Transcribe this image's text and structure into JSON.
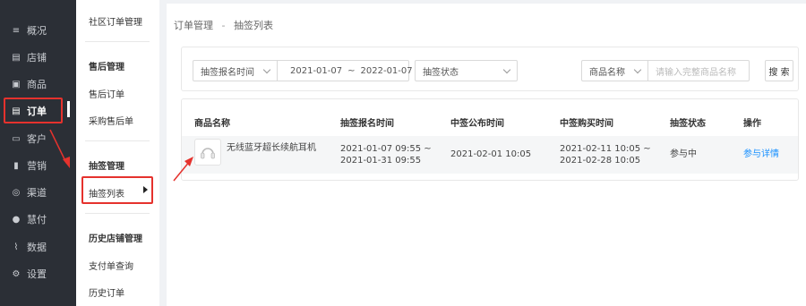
{
  "nav": {
    "items": [
      {
        "label": "概况",
        "icon": "list-icon",
        "glyph": "≡"
      },
      {
        "label": "店铺",
        "icon": "store-icon",
        "glyph": "▤"
      },
      {
        "label": "商品",
        "icon": "bag-icon",
        "glyph": "▣"
      },
      {
        "label": "订单",
        "icon": "order-icon",
        "glyph": "▤"
      },
      {
        "label": "客户",
        "icon": "customer-icon",
        "glyph": "▭"
      },
      {
        "label": "营销",
        "icon": "chart-icon",
        "glyph": "▮"
      },
      {
        "label": "渠道",
        "icon": "channel-icon",
        "glyph": "◎"
      },
      {
        "label": "慧付",
        "icon": "pay-icon",
        "glyph": "●"
      },
      {
        "label": "数据",
        "icon": "data-icon",
        "glyph": "⌇"
      },
      {
        "label": "设置",
        "icon": "settings-icon",
        "glyph": "⚙"
      }
    ],
    "active_index": 3
  },
  "submenu": {
    "community_orders": "社区订单管理",
    "after_sale_group": "售后管理",
    "after_sale_orders": "售后订单",
    "purchase_after_sale": "采购售后单",
    "lottery_group": "抽签管理",
    "lottery_list": "抽签列表",
    "history_group": "历史店铺管理",
    "payment_query": "支付单查询",
    "history_orders": "历史订单"
  },
  "breadcrumb": {
    "parent": "订单管理",
    "separator": "-",
    "current": "抽签列表"
  },
  "filters": {
    "time_type": "抽签报名时间",
    "date_start": "2021-01-07",
    "date_sep": "~",
    "date_end": "2022-01-07",
    "status_placeholder": "抽签状态",
    "product_field": "商品名称",
    "product_placeholder": "请输入完整商品名称",
    "search_label": "搜 索"
  },
  "table": {
    "headers": [
      "商品名称",
      "抽签报名时间",
      "中签公布时间",
      "中签购买时间",
      "抽签状态",
      "操作"
    ],
    "rows": [
      {
        "product": "无线蓝牙超长续航耳机",
        "signup_start": "2021-01-07 09:55 ~",
        "signup_end": "2021-01-31 09:55",
        "announce": "2021-02-01 10:05",
        "buy_start": "2021-02-11 10:05 ~",
        "buy_end": "2021-02-28 10:05",
        "status": "参与中",
        "action": "参与详情"
      }
    ]
  },
  "colors": {
    "nav_bg": "#2b2f36",
    "highlight": "#e5322d",
    "link": "#1890ff"
  }
}
